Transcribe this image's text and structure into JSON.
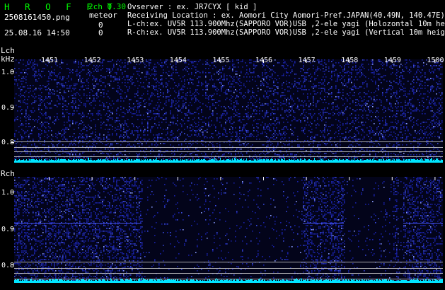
{
  "header": {
    "brand": "H R O F F T",
    "mode": "2ch 0.30",
    "filename": "2508161450.png",
    "timestamp": "25.08.16 14:50",
    "meteor_label": "meteor",
    "meteor_count_l": "0",
    "meteor_count_r": "0",
    "observer": "Ovserver           : ex. JR7CYX [ kid ]",
    "location": "Receiving Location : ex. Aomori City Aomori-Pref.JAPAN(40.49N, 140.47E)",
    "lch_info": "L-ch:ex. UV5R 113.900Mhz(SAPPORO VOR)USB ,2-ele yagi (Holozontal 10m height)",
    "rch_info": "R-ch:ex. UV5R 113.900Mhz(SAPPORO VOR)USB ,2-ele yagi (Vertical 10m height)"
  },
  "time_axis": [
    "1451",
    "1452",
    "1453",
    "1454",
    "1455",
    "1456",
    "1457",
    "1458",
    "1459",
    "1500"
  ],
  "lch": {
    "label": "Lch",
    "unit": "kHz",
    "ticks": [
      "1.0",
      "0.9",
      "0.8"
    ]
  },
  "rch": {
    "label": "Rch",
    "ticks": [
      "1.0",
      "0.9",
      "0.8"
    ]
  },
  "colors": {
    "background": "#000000",
    "text_green": "#00ff00",
    "noise": "#1a22c8",
    "bright": "#6b7cff",
    "baseline": "#00e5ff",
    "grid": "#c8c8c8"
  }
}
